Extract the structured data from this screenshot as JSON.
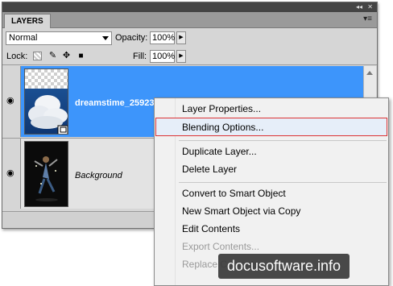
{
  "panel": {
    "title": "LAYERS",
    "blend_mode": "Normal",
    "opacity_label": "Opacity:",
    "opacity_value": "100%",
    "lock_label": "Lock:",
    "fill_label": "Fill:",
    "fill_value": "100%"
  },
  "layers": [
    {
      "name": "dreamstime_25923",
      "selected": true,
      "visible": true,
      "thumbnail": "clouds-on-blue-sky"
    },
    {
      "name": "Background",
      "selected": false,
      "visible": true,
      "thumbnail": "dancer-on-dark"
    }
  ],
  "context_menu": {
    "items": [
      {
        "label": "Layer Properties...",
        "disabled": false
      },
      {
        "label": "Blending Options...",
        "disabled": false,
        "highlighted": true
      },
      {
        "label": "Duplicate Layer...",
        "disabled": false
      },
      {
        "label": "Delete Layer",
        "disabled": false
      },
      {
        "label": "Convert to Smart Object",
        "disabled": false
      },
      {
        "label": "New Smart Object via Copy",
        "disabled": false
      },
      {
        "label": "Edit Contents",
        "disabled": false
      },
      {
        "label": "Export Contents...",
        "disabled": true
      },
      {
        "label": "Replace Contents...",
        "disabled": true
      }
    ]
  },
  "watermark": "docusoftware.info",
  "colors": {
    "selection": "#3d95fb",
    "highlight_border": "#dd3333",
    "panel_bg": "#d6d6d6"
  },
  "icons": [
    "eye-icon",
    "lock-transparent-icon",
    "lock-paint-icon",
    "lock-move-icon",
    "lock-all-icon",
    "panel-menu-icon",
    "collapse-icon"
  ]
}
